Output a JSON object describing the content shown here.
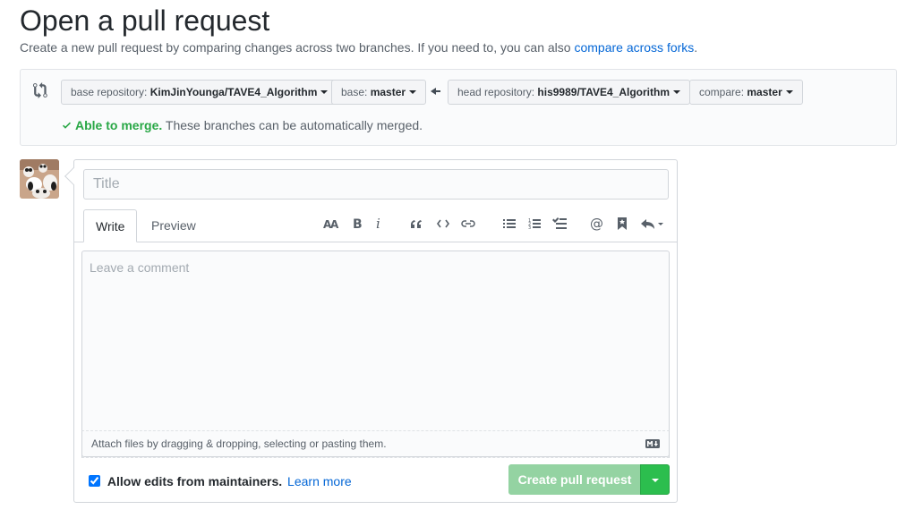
{
  "header": {
    "title": "Open a pull request",
    "subtitle": "Create a new pull request by comparing changes across two branches. If you need to, you can also",
    "subtitle_link": "compare across forks",
    "subtitle_end": "."
  },
  "range": {
    "base_repo_label": "base repository:",
    "base_repo_value": "KimJinYounga/TAVE4_Algorithm",
    "base_label": "base:",
    "base_value": "master",
    "head_repo_label": "head repository:",
    "head_repo_value": "his9989/TAVE4_Algorithm",
    "compare_label": "compare:",
    "compare_value": "master",
    "merge_ok": "Able to merge.",
    "merge_msg": "These branches can be automatically merged."
  },
  "form": {
    "title_placeholder": "Title",
    "tab_write": "Write",
    "tab_preview": "Preview",
    "comment_placeholder": "Leave a comment",
    "attach_text": "Attach files by dragging & dropping, selecting or pasting them.",
    "allow_edits_label": "Allow edits from maintainers.",
    "learn_more": "Learn more",
    "create_label": "Create pull request",
    "allow_edits_checked": true
  },
  "toolbar": {
    "icons": [
      "text-size-icon",
      "bold-icon",
      "italic-icon",
      "quote-icon",
      "code-icon",
      "link-icon",
      "bullet-list-icon",
      "numbered-list-icon",
      "task-list-icon",
      "mention-icon",
      "bookmark-icon",
      "reply-icon"
    ]
  },
  "colors": {
    "link": "#0366d6",
    "success": "#28a745",
    "create_disabled": "#94d3a2"
  }
}
